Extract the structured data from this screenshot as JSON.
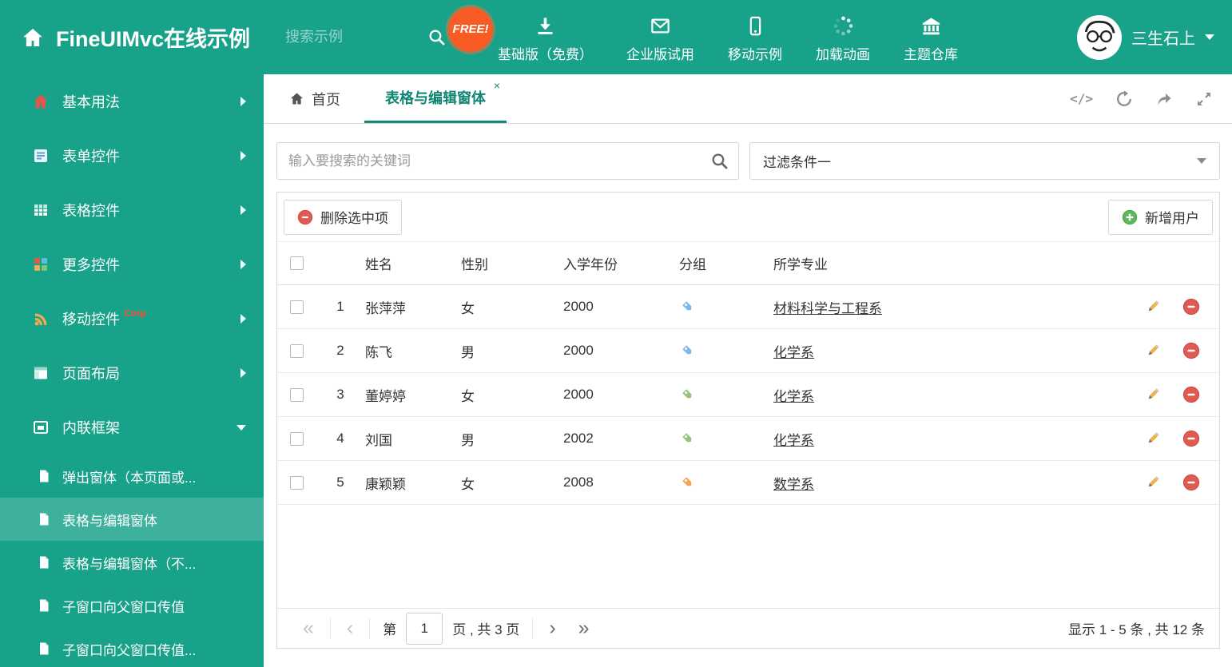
{
  "colors": {
    "brand_teal": "#18a28a",
    "active_tab_teal": "#0e8573",
    "free_badge_orange": "#f95b25",
    "delete_red": "#e05a52",
    "add_green": "#5cb85c",
    "edit_yellow": "#eeb24c"
  },
  "header": {
    "title": "FineUIMvc在线示例",
    "search_placeholder": "搜索示例",
    "free_badge": "FREE!",
    "nav": [
      {
        "label": "基础版（免费）",
        "icon": "download-icon"
      },
      {
        "label": "企业版试用",
        "icon": "envelope-icon"
      },
      {
        "label": "移动示例",
        "icon": "mobile-icon"
      },
      {
        "label": "加载动画",
        "icon": "spinner-icon"
      },
      {
        "label": "主题仓库",
        "icon": "bank-icon"
      }
    ],
    "user_name": "三生石上"
  },
  "sidebar": {
    "items": [
      {
        "label": "基本用法",
        "icon": "home-icon"
      },
      {
        "label": "表单控件",
        "icon": "form-icon"
      },
      {
        "label": "表格控件",
        "icon": "table-icon"
      },
      {
        "label": "更多控件",
        "icon": "widgets-icon"
      },
      {
        "label": "移动控件",
        "icon": "signal-icon",
        "badge": "Corp"
      },
      {
        "label": "页面布局",
        "icon": "layout-icon"
      },
      {
        "label": "内联框架",
        "icon": "frame-icon",
        "expanded": true
      }
    ],
    "subitems": [
      {
        "label": "弹出窗体（本页面或...",
        "icon": "file-icon"
      },
      {
        "label": "表格与编辑窗体",
        "icon": "file-icon",
        "active": true
      },
      {
        "label": "表格与编辑窗体（不...",
        "icon": "file-icon"
      },
      {
        "label": "子窗口向父窗口传值",
        "icon": "file-icon"
      },
      {
        "label": "子窗口向父窗口传值...",
        "icon": "file-icon"
      }
    ]
  },
  "tabs": {
    "home_label": "首页",
    "active_label": "表格与编辑窗体",
    "close_icon": "×",
    "tools_code_icon": "</>"
  },
  "filters": {
    "keyword_placeholder": "输入要搜索的关键词",
    "filter_value": "过滤条件一"
  },
  "toolbar": {
    "delete_label": "删除选中项",
    "add_label": "新增用户"
  },
  "table": {
    "headers": {
      "name": "姓名",
      "gender": "性别",
      "year": "入学年份",
      "group": "分组",
      "major": "所学专业"
    },
    "rows": [
      {
        "index": "1",
        "name": "张萍萍",
        "gender": "女",
        "year": "2000",
        "tag_color": "#7db8e8",
        "major": "材料科学与工程系"
      },
      {
        "index": "2",
        "name": "陈飞",
        "gender": "男",
        "year": "2000",
        "tag_color": "#7db8e8",
        "major": "化学系"
      },
      {
        "index": "3",
        "name": "董婷婷",
        "gender": "女",
        "year": "2000",
        "tag_color": "#94c47a",
        "major": "化学系"
      },
      {
        "index": "4",
        "name": "刘国",
        "gender": "男",
        "year": "2002",
        "tag_color": "#94c47a",
        "major": "化学系"
      },
      {
        "index": "5",
        "name": "康颖颖",
        "gender": "女",
        "year": "2008",
        "tag_color": "#f3a65a",
        "major": "数学系"
      }
    ]
  },
  "pagination": {
    "first_icon": "«",
    "prev_icon": "‹",
    "next_icon": "›",
    "last_icon": "»",
    "page_prefix": "第",
    "current_page": "1",
    "page_suffix": "页 , 共 3 页",
    "summary": "显示 1 - 5 条 , 共 12 条"
  }
}
